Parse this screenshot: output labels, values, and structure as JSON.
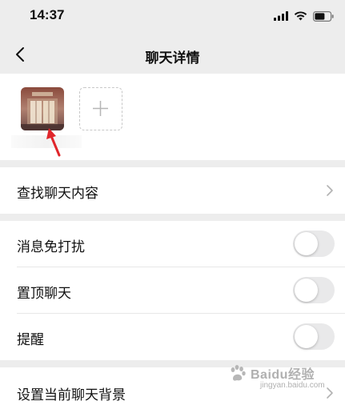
{
  "status_bar": {
    "time": "14:37",
    "icons": [
      "signal-icon",
      "wifi-icon",
      "battery-icon"
    ]
  },
  "nav": {
    "title": "聊天详情",
    "back_icon": "chevron-left-icon"
  },
  "members": {
    "add_icon": "plus-icon"
  },
  "search_history": {
    "label": "查找聊天内容"
  },
  "settings": [
    {
      "label": "消息免打扰",
      "enabled": false
    },
    {
      "label": "置顶聊天",
      "enabled": false
    },
    {
      "label": "提醒",
      "enabled": false
    }
  ],
  "background": {
    "label": "设置当前聊天背景"
  },
  "watermark": {
    "brand": "Baidu经验",
    "url": "jingyan.baidu.com"
  },
  "colors": {
    "background": "#ededed",
    "cell": "#ffffff",
    "toggle_off": "#e9e9ea",
    "annotation_arrow": "#e0262b"
  }
}
